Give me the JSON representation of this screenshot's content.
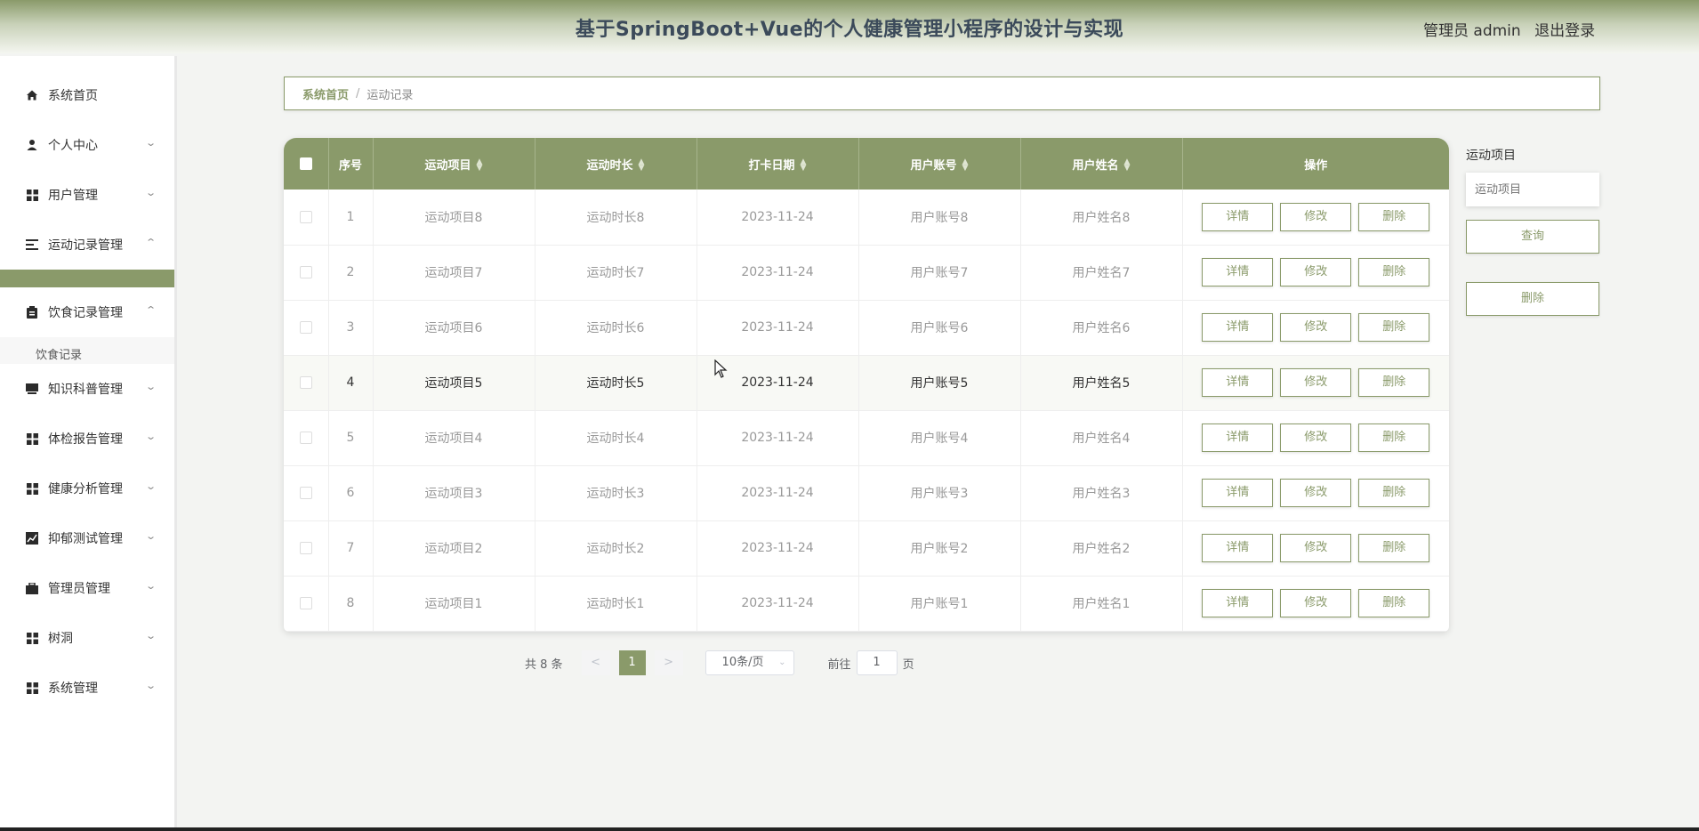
{
  "header": {
    "title": "基于SpringBoot+Vue的个人健康管理小程序的设计与实现",
    "admin": "管理员 admin",
    "logout": "退出登录"
  },
  "sidebar": {
    "items": [
      {
        "label": "系统首页",
        "icon": "home-icon"
      },
      {
        "label": "个人中心",
        "icon": "user-icon"
      },
      {
        "label": "用户管理",
        "icon": "grid-icon"
      },
      {
        "label": "运动记录管理",
        "icon": "list-icon"
      },
      {
        "label": "饮食记录管理",
        "icon": "clipboard-icon"
      },
      {
        "label": "知识科普管理",
        "icon": "book-icon"
      },
      {
        "label": "体检报告管理",
        "icon": "grid-icon"
      },
      {
        "label": "健康分析管理",
        "icon": "grid-icon"
      },
      {
        "label": "抑郁测试管理",
        "icon": "chart-icon"
      },
      {
        "label": "管理员管理",
        "icon": "briefcase-icon"
      },
      {
        "label": "树洞",
        "icon": "grid-icon"
      },
      {
        "label": "系统管理",
        "icon": "grid-icon"
      }
    ],
    "sub_item": "饮食记录"
  },
  "breadcrumb": {
    "home": "系统首页",
    "separator": "/",
    "current": "运动记录"
  },
  "table": {
    "columns": [
      "序号",
      "运动项目",
      "运动时长",
      "打卡日期",
      "用户账号",
      "用户姓名",
      "操作"
    ],
    "rows": [
      {
        "index": "1",
        "item": "运动项目8",
        "duration": "运动时长8",
        "date": "2023-11-24",
        "account": "用户账号8",
        "name": "用户姓名8"
      },
      {
        "index": "2",
        "item": "运动项目7",
        "duration": "运动时长7",
        "date": "2023-11-24",
        "account": "用户账号7",
        "name": "用户姓名7"
      },
      {
        "index": "3",
        "item": "运动项目6",
        "duration": "运动时长6",
        "date": "2023-11-24",
        "account": "用户账号6",
        "name": "用户姓名6"
      },
      {
        "index": "4",
        "item": "运动项目5",
        "duration": "运动时长5",
        "date": "2023-11-24",
        "account": "用户账号5",
        "name": "用户姓名5"
      },
      {
        "index": "5",
        "item": "运动项目4",
        "duration": "运动时长4",
        "date": "2023-11-24",
        "account": "用户账号4",
        "name": "用户姓名4"
      },
      {
        "index": "6",
        "item": "运动项目3",
        "duration": "运动时长3",
        "date": "2023-11-24",
        "account": "用户账号3",
        "name": "用户姓名3"
      },
      {
        "index": "7",
        "item": "运动项目2",
        "duration": "运动时长2",
        "date": "2023-11-24",
        "account": "用户账号2",
        "name": "用户姓名2"
      },
      {
        "index": "8",
        "item": "运动项目1",
        "duration": "运动时长1",
        "date": "2023-11-24",
        "account": "用户账号1",
        "name": "用户姓名1"
      }
    ],
    "actions": {
      "detail": "详情",
      "edit": "修改",
      "delete": "删除"
    }
  },
  "search": {
    "label": "运动项目",
    "placeholder": "运动项目",
    "query_button": "查询",
    "delete_button": "删除"
  },
  "pagination": {
    "total": "共 8 条",
    "prev": "<",
    "current_page": "1",
    "next": ">",
    "page_size": "10条/页",
    "goto_prefix": "前往",
    "goto_value": "1",
    "goto_suffix": "页"
  },
  "colors": {
    "accent": "#8a9a6a",
    "header_text": "#3b4a5a"
  }
}
